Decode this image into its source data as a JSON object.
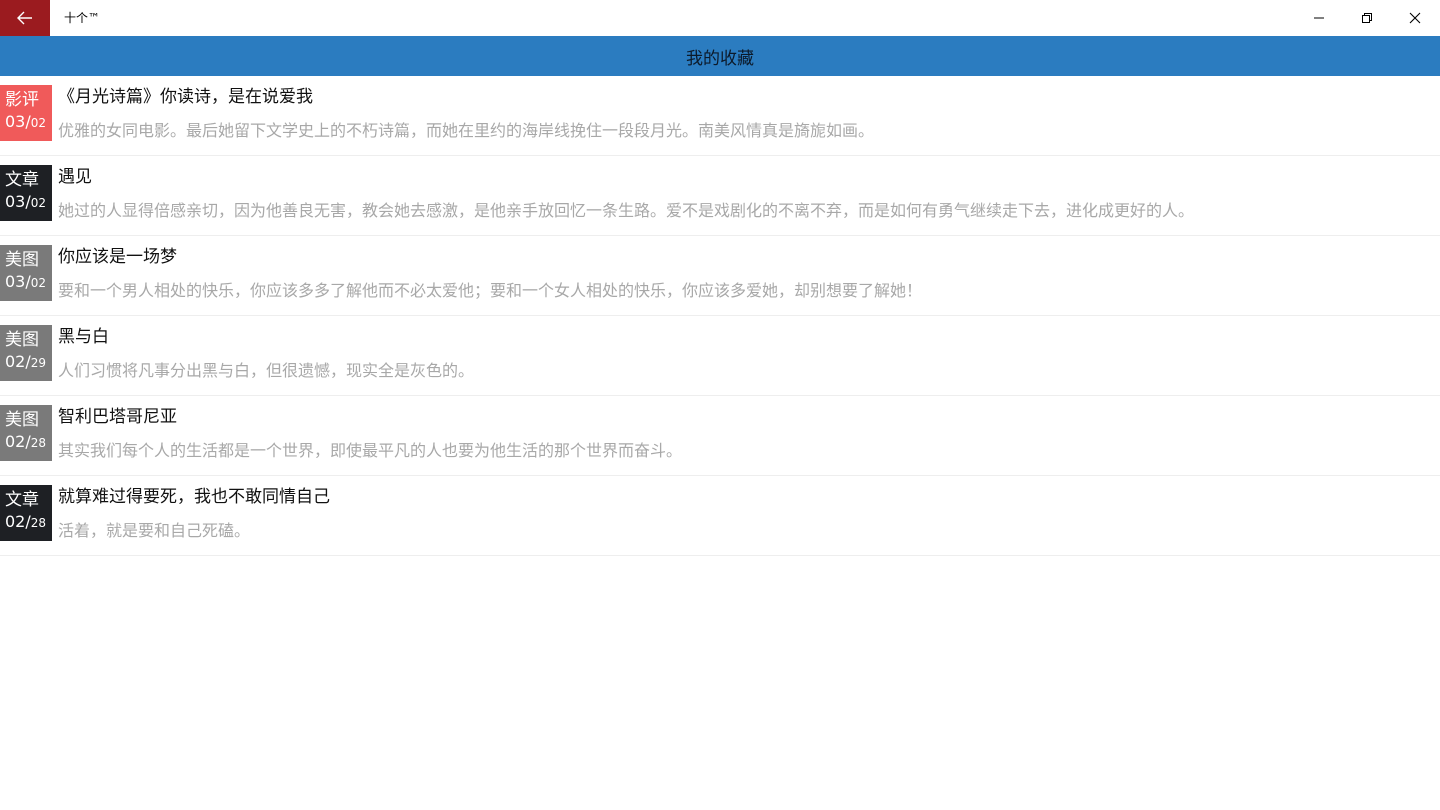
{
  "window": {
    "title": "十个™"
  },
  "header": {
    "title": "我的收藏"
  },
  "colors": {
    "back_button": "#9b1b1f",
    "header_bg": "#2b7cc0",
    "badge_movie": "#f05a5a",
    "badge_article": "#1e2024",
    "badge_image": "#7a7a7a"
  },
  "items": [
    {
      "category": "影评",
      "month": "03/",
      "day": "02",
      "badge_color": "#f05a5a",
      "title": "《月光诗篇》你读诗，是在说爱我",
      "desc": "优雅的女同电影。最后她留下文学史上的不朽诗篇，而她在里约的海岸线挽住一段段月光。南美风情真是旖旎如画。"
    },
    {
      "category": "文章",
      "month": "03/",
      "day": "02",
      "badge_color": "#1e2024",
      "title": "遇见",
      "desc": "她过的人显得倍感亲切，因为他善良无害，教会她去感激，是他亲手放回忆一条生路。爱不是戏剧化的不离不弃，而是如何有勇气继续走下去，进化成更好的人。"
    },
    {
      "category": "美图",
      "month": "03/",
      "day": "02",
      "badge_color": "#7a7a7a",
      "title": "你应该是一场梦",
      "desc": "要和一个男人相处的快乐，你应该多多了解他而不必太爱他；要和一个女人相处的快乐，你应该多爱她，却别想要了解她！"
    },
    {
      "category": "美图",
      "month": "02/",
      "day": "29",
      "badge_color": "#7a7a7a",
      "title": "黑与白",
      "desc": "人们习惯将凡事分出黑与白，但很遗憾，现实全是灰色的。"
    },
    {
      "category": "美图",
      "month": "02/",
      "day": "28",
      "badge_color": "#7a7a7a",
      "title": "智利巴塔哥尼亚",
      "desc": "其实我们每个人的生活都是一个世界，即使最平凡的人也要为他生活的那个世界而奋斗。"
    },
    {
      "category": "文章",
      "month": "02/",
      "day": "28",
      "badge_color": "#1e2024",
      "title": "就算难过得要死，我也不敢同情自己",
      "desc": "活着，就是要和自己死磕。"
    }
  ]
}
